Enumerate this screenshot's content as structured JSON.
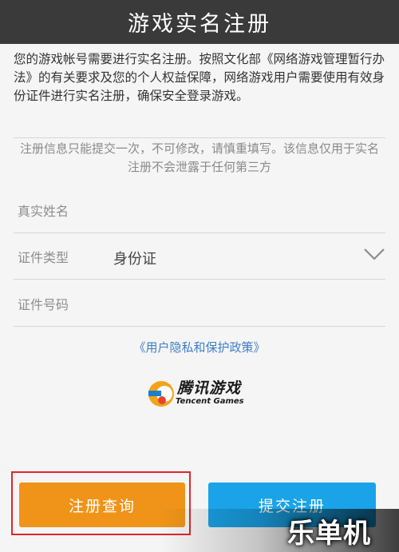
{
  "header": {
    "title": "游戏实名注册"
  },
  "intro": {
    "text": "您的游戏帐号需要进行实名注册。按照文化部《网络游戏管理暂行办法》的有关要求及您的个人权益保障，网络游戏用户需要使用有效身份证件进行实名注册，确保安全登录游戏。"
  },
  "notice": {
    "text": "注册信息只能提交一次，不可修改，请慎重填写。该信息仅用于实名注册不会泄露于任何第三方"
  },
  "form": {
    "name_label": "真实姓名",
    "id_type_label": "证件类型",
    "id_type_value": "身份证",
    "id_number_label": "证件号码"
  },
  "policy": {
    "link_text": "《用户隐私和保护政策》"
  },
  "logo": {
    "cn": "腾讯游戏",
    "en": "Tencent Games"
  },
  "buttons": {
    "query": "注册查询",
    "submit": "提交注册"
  },
  "watermark": {
    "text": "乐单机"
  },
  "colors": {
    "query_button": "#ef9419",
    "submit_button": "#1aa3e8",
    "highlight": "#e0262a",
    "link": "#3f7fc8"
  }
}
